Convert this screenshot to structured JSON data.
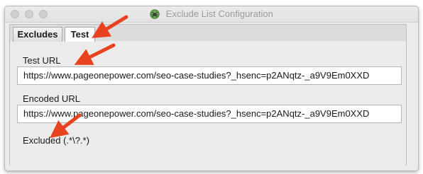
{
  "window": {
    "title": "Exclude List Configuration",
    "icon": "spider-icon"
  },
  "tabs": [
    {
      "label": "Excludes",
      "selected": false
    },
    {
      "label": "Test",
      "selected": true
    }
  ],
  "test_url": {
    "label": "Test URL",
    "value": "https://www.pageonepower.com/seo-case-studies?_hsenc=p2ANqtz-_a9V9Em0XXD"
  },
  "encoded_url": {
    "label": "Encoded URL",
    "value": "https://www.pageonepower.com/seo-case-studies?_hsenc=p2ANqtz-_a9V9Em0XXD"
  },
  "result": {
    "text": "Excluded (.*\\?.*)"
  },
  "colors": {
    "annotation_arrow": "#e8421e",
    "window_bg": "#ececec"
  }
}
